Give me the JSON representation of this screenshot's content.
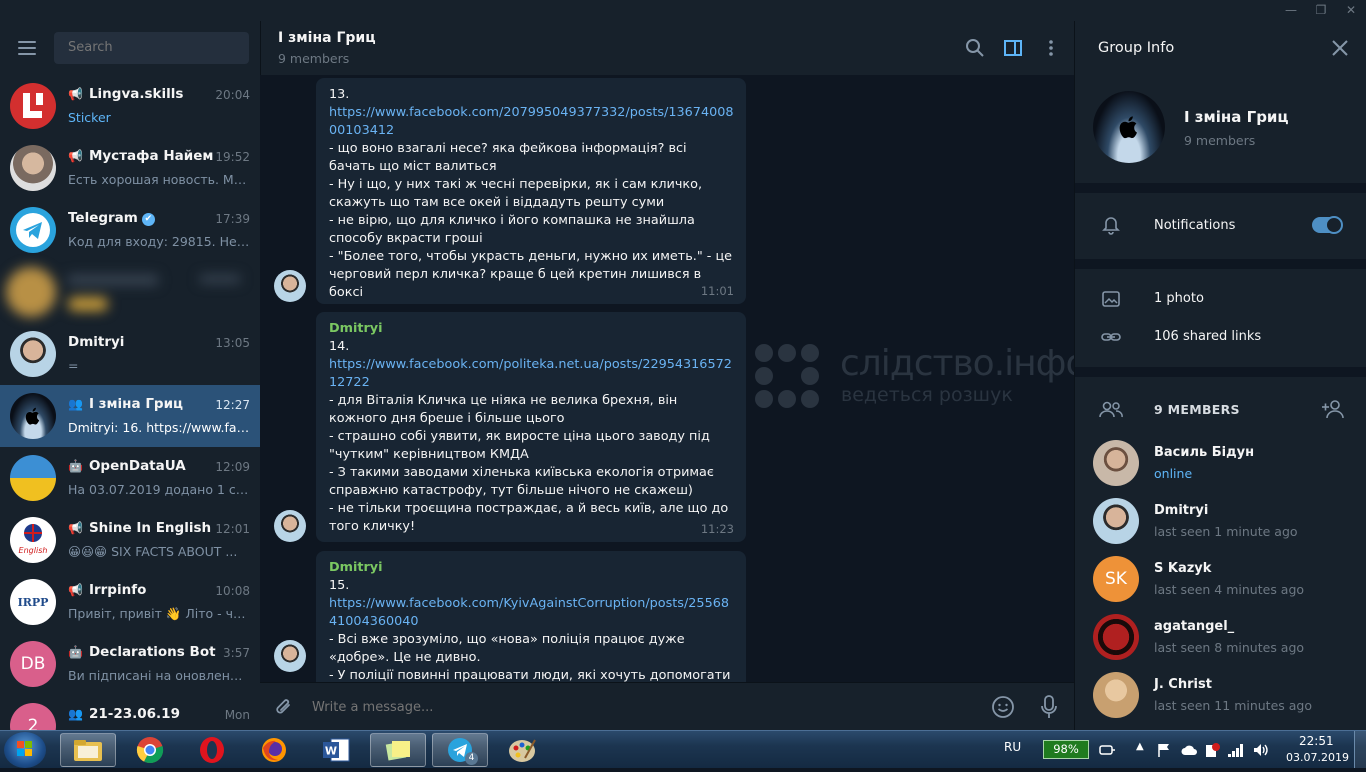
{
  "window": {
    "minimize": "—",
    "maximize": "❐",
    "close": "✕"
  },
  "search": {
    "placeholder": "Search"
  },
  "chats": [
    {
      "name": "Lingva.skills",
      "time": "20:04",
      "preview": "Sticker",
      "prefix": "channel",
      "avatar_color": "#d32f2f"
    },
    {
      "name": "Мустафа Найем",
      "time": "19:52",
      "preview": "Есть хорошая новость. Мы ...",
      "prefix": "channel",
      "avatar_color": "#8c8c8c"
    },
    {
      "name": "Telegram",
      "time": "17:39",
      "preview": "Код для входу: 29815. Не по...",
      "prefix": "",
      "avatar_color": "#2aa3dd",
      "verified": "✔"
    },
    {
      "name": "",
      "time": "",
      "preview": "",
      "prefix": "",
      "avatar_color": "#b89045"
    },
    {
      "name": "Dmitryi",
      "time": "13:05",
      "preview": "=",
      "prefix": "",
      "avatar_color": "#88a6bb"
    },
    {
      "name": "І зміна Гриц",
      "time": "12:27",
      "preview": "Dmitryi: 16. https://www.face...",
      "prefix": "group",
      "avatar_color": "#1a2733"
    },
    {
      "name": "OpenDataUA",
      "time": "12:09",
      "preview": "На 03.07.2019 додано 1 судо...",
      "prefix": "bot",
      "avatar_color": "#f0c020"
    },
    {
      "name": "Shine In English",
      "time": "12:01",
      "preview": "😀😃😁 SIX FACTS ABOUT ...",
      "prefix": "channel",
      "avatar_color": "#ffffff"
    },
    {
      "name": "Irrpinfo",
      "time": "10:08",
      "preview": "Привіт, привіт 👋 Літо - ча...",
      "prefix": "channel",
      "avatar_color": "#ffffff"
    },
    {
      "name": "Declarations Bot",
      "time": "3:57",
      "preview": "Ви підписані на оновлення ...",
      "prefix": "bot",
      "avatar_color": "#d95f8b",
      "initials": "DB"
    },
    {
      "name": "21-23.06.19",
      "time": "Mon",
      "preview": "",
      "prefix": "group",
      "avatar_color": "#d95f8b",
      "initials": "2"
    }
  ],
  "chat_header": {
    "title": "І зміна Гриц",
    "subtitle": "9 members"
  },
  "messages": [
    {
      "sender": "",
      "lines_before": [
        "13."
      ],
      "link": "https://www.facebook.com/207995049377332/posts/1367400800103412",
      "body": "- що воно взагалі несе? яка фейкова інформація? всі бачать що міст валиться\n- Ну і що, у них такі ж чесні перевірки, як і сам кличко, скажуть що там все окей і віддадуть решту суми\n- не вірю, що для кличко і його компашка не знайшла способу вкрасти гроші\n- \"Более того, чтобы украсть деньги, нужно их иметь.\" - це черговий перл кличка? краще б цей кретин лишився в боксі",
      "time": "11:01"
    },
    {
      "sender": "Dmitryi",
      "lines_before": [
        "14."
      ],
      "link": "https://www.facebook.com/politeka.net.ua/posts/2295431657212722",
      "body": "- для Віталія Кличка це ніяка не велика брехня, він кожного дня бреше і більше цього\n- страшно собі уявити, як виросте ціна цього заводу під \"чутким\" керівництвом КМДА\n- З такими заводами хіленька київська екологія отримає справжню катастрофу, тут більше нічого не скажеш)\n- не тільки троєщина постраждає, а й весь київ, але що до того кличку!",
      "time": "11:23"
    },
    {
      "sender": "Dmitryi",
      "lines_before": [
        "15."
      ],
      "link": "https://www.facebook.com/KyivAgainstCorruption/posts/2556841004360040",
      "body": "- Всі вже зрозуміло, що «нова» поліція працює дуже «добре». Це не дивно.\n- У поліції повинні працювати люди, які хочуть допомогати",
      "time": ""
    }
  ],
  "watermark": {
    "title": "слідство.інфо",
    "subtitle": "ведеться розшук"
  },
  "composer": {
    "placeholder": "Write a message..."
  },
  "group_info": {
    "title": "Group Info",
    "name": "І зміна Гриц",
    "members_count": "9 members",
    "notifications_label": "Notifications",
    "notifications_on": true,
    "photos": "1 photo",
    "links": "106 shared links",
    "members_header": "9 MEMBERS",
    "members": [
      {
        "name": "Василь Бідун",
        "status": "online",
        "online": true,
        "avatar_color": "#9a8070"
      },
      {
        "name": "Dmitryi",
        "status": "last seen 1 minute ago",
        "avatar_color": "#88a6bb"
      },
      {
        "name": "S Kazyk",
        "status": "last seen 4 minutes ago",
        "avatar_color": "#ee9238",
        "initials": "SK"
      },
      {
        "name": "agatangel_",
        "status": "last seen 8 minutes ago",
        "avatar_color": "#b02020"
      },
      {
        "name": "J. Christ",
        "status": "last seen 11 minutes ago",
        "avatar_color": "#c8a070"
      }
    ]
  },
  "taskbar": {
    "language": "RU",
    "battery": "98%",
    "time": "22:51",
    "date": "03.07.2019",
    "telegram_badge": "4"
  }
}
